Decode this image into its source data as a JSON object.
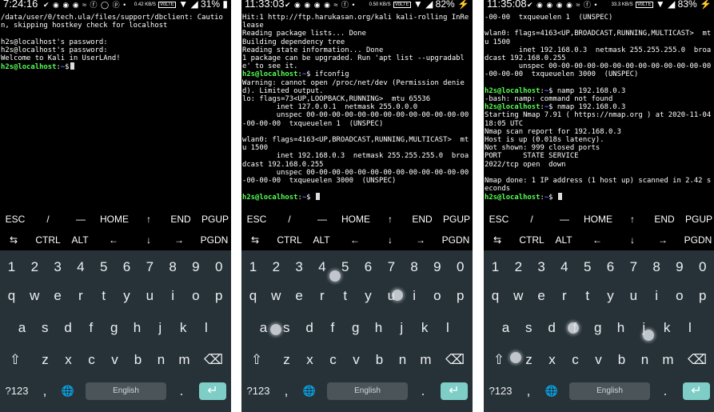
{
  "panels": [
    {
      "status": {
        "time": "7:24:16",
        "icons": "✔ ◉ ◉ ◉ ≈ ⓕ ◯ ⓟ •",
        "speed": "0.42 KB/S",
        "lte": "VoLTE",
        "battery": "31%"
      },
      "lines": [
        {
          "t": "/data/user/0/tech.ula/files/support/dbclient: Caution, skipping hostkey check for localhost"
        },
        {
          "t": ""
        },
        {
          "t": "h2s@localhost's password:"
        },
        {
          "t": "h2s@localhost's password:"
        },
        {
          "t": "Welcome to Kali in UserLAnd!"
        },
        {
          "prompt": true,
          "cmd": ""
        }
      ]
    },
    {
      "status": {
        "time": "11:33:03",
        "icons": "✔ ◉ ◉ ◉ ◉ ≈ ⓕ •",
        "speed": "0.50 KB/S",
        "lte": "VoLTE",
        "battery": "82%"
      },
      "lines": [
        {
          "t": "Hit:1 http://ftp.harukasan.org/kali kali-rolling InRelease"
        },
        {
          "t": "Reading package lists... Done"
        },
        {
          "t": "Building dependency tree"
        },
        {
          "t": "Reading state information... Done"
        },
        {
          "t": "1 package can be upgraded. Run 'apt list --upgradable' to see it."
        },
        {
          "prompt": true,
          "cmd": " ifconfig"
        },
        {
          "t": "Warning: cannot open /proc/net/dev (Permission denied). Limited output."
        },
        {
          "t": "lo: flags=73<UP,LOOPBACK,RUNNING>  mtu 65536"
        },
        {
          "t": "        inet 127.0.0.1  netmask 255.0.0.0"
        },
        {
          "t": "        unspec 00-00-00-00-00-00-00-00-00-00-00-00-00-00-00-00  txqueuelen 1  (UNSPEC)"
        },
        {
          "t": ""
        },
        {
          "t": "wlan0: flags=4163<UP,BROADCAST,RUNNING,MULTICAST>  mtu 1500"
        },
        {
          "t": "        inet 192.168.0.3  netmask 255.255.255.0  broadcast 192.168.0.255"
        },
        {
          "t": "        unspec 00-00-00-00-00-00-00-00-00-00-00-00-00-00-00-00  txqueuelen 3000  (UNSPEC)"
        },
        {
          "t": ""
        },
        {
          "prompt": true,
          "cmd": " "
        }
      ]
    },
    {
      "status": {
        "time": "11:35:08",
        "icons": "✔ ◉ ◉ ◉ ◉ ≈ ⓕ •",
        "speed": "33.3 KB/S",
        "lte": "VoLTE",
        "battery": "83%"
      },
      "lines": [
        {
          "t": "-00-00  txqueuelen 1  (UNSPEC)"
        },
        {
          "t": ""
        },
        {
          "t": "wlan0: flags=4163<UP,BROADCAST,RUNNING,MULTICAST>  mtu 1500"
        },
        {
          "t": "        inet 192.168.0.3  netmask 255.255.255.0  broadcast 192.168.0.255"
        },
        {
          "t": "        unspec 00-00-00-00-00-00-00-00-00-00-00-00-00-00-00-00  txqueuelen 3000  (UNSPEC)"
        },
        {
          "t": ""
        },
        {
          "prompt": true,
          "cmd": " namp 192.168.0.3"
        },
        {
          "t": "-bash: namp: command not found"
        },
        {
          "prompt": true,
          "cmd": " nmap 192.168.0.3"
        },
        {
          "t": "Starting Nmap 7.91 ( https://nmap.org ) at 2020-11-04 18:05 UTC"
        },
        {
          "t": "Nmap scan report for 192.168.0.3"
        },
        {
          "t": "Host is up (0.018s latency)."
        },
        {
          "t": "Not shown: 999 closed ports"
        },
        {
          "t": "PORT     STATE SERVICE"
        },
        {
          "t": "2022/tcp open  down"
        },
        {
          "t": ""
        },
        {
          "t": "Nmap done: 1 IP address (1 host up) scanned in 2.42 seconds"
        },
        {
          "prompt": true,
          "cmd": " "
        }
      ]
    }
  ],
  "prompt": {
    "user": "h2s@localhost",
    "sep": ":",
    "path": "~",
    "symbol": "$"
  },
  "extra_keys": {
    "row1": [
      "ESC",
      "/",
      "—",
      "HOME",
      "↑",
      "END",
      "PGUP"
    ],
    "row2": [
      "⇆",
      "CTRL",
      "ALT",
      "←",
      "↓",
      "→",
      "PGDN"
    ]
  },
  "keyboard": {
    "numbers": [
      "1",
      "2",
      "3",
      "4",
      "5",
      "6",
      "7",
      "8",
      "9",
      "0"
    ],
    "row1": [
      "q",
      "w",
      "e",
      "r",
      "t",
      "y",
      "u",
      "i",
      "o",
      "p"
    ],
    "row2": [
      "a",
      "s",
      "d",
      "f",
      "g",
      "h",
      "j",
      "k",
      "l"
    ],
    "row3": [
      "z",
      "x",
      "c",
      "v",
      "b",
      "n",
      "m"
    ],
    "shift": "⇧",
    "backspace": "⌫",
    "symbols": "?123",
    "comma": ",",
    "globe": "🌐",
    "space_label": "English",
    "period": ".",
    "enter": "↵"
  },
  "colors": {
    "prompt_user": "#55ff55",
    "prompt_path": "#5577ff",
    "keyboard_bg": "#263238",
    "enter_key": "#7ecdc6"
  }
}
